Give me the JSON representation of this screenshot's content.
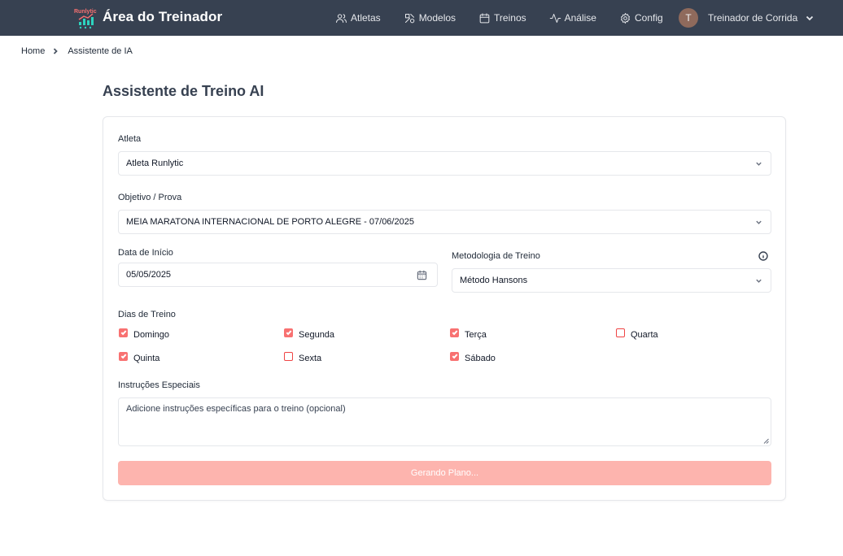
{
  "app": {
    "brand_title": "Área do Treinador",
    "logo_text": "Runlytic"
  },
  "nav": {
    "items": [
      {
        "label": "Atletas",
        "icon": "users-icon"
      },
      {
        "label": "Modelos",
        "icon": "shapes-icon"
      },
      {
        "label": "Treinos",
        "icon": "calendar-icon"
      },
      {
        "label": "Análise",
        "icon": "activity-icon"
      },
      {
        "label": "Config",
        "icon": "gear-icon"
      }
    ],
    "user": {
      "initial": "T",
      "name": "Treinador de Corrida"
    }
  },
  "breadcrumb": {
    "home": "Home",
    "current": "Assistente de IA"
  },
  "page": {
    "title": "Assistente de Treino AI"
  },
  "form": {
    "athlete": {
      "label": "Atleta",
      "value": "Atleta Runlytic"
    },
    "goal": {
      "label": "Objetivo / Prova",
      "value": "MEIA MARATONA INTERNACIONAL DE PORTO ALEGRE - 07/06/2025"
    },
    "start_date": {
      "label": "Data de Início",
      "value": "05/05/2025"
    },
    "methodology": {
      "label": "Metodologia de Treino",
      "value": "Método Hansons"
    },
    "days": {
      "label": "Dias de Treino",
      "items": [
        {
          "label": "Domingo",
          "checked": true
        },
        {
          "label": "Segunda",
          "checked": true
        },
        {
          "label": "Terça",
          "checked": true
        },
        {
          "label": "Quarta",
          "checked": false
        },
        {
          "label": "Quinta",
          "checked": true
        },
        {
          "label": "Sexta",
          "checked": false
        },
        {
          "label": "Sábado",
          "checked": true
        }
      ]
    },
    "instructions": {
      "label": "Instruções Especiais",
      "placeholder": "Adicione instruções específicas para o treino (opcional)"
    },
    "submit_label": "Gerando Plano..."
  },
  "colors": {
    "navbar": "#374151",
    "accent": "#f87171",
    "button_disabled": "#fdb4ae"
  }
}
